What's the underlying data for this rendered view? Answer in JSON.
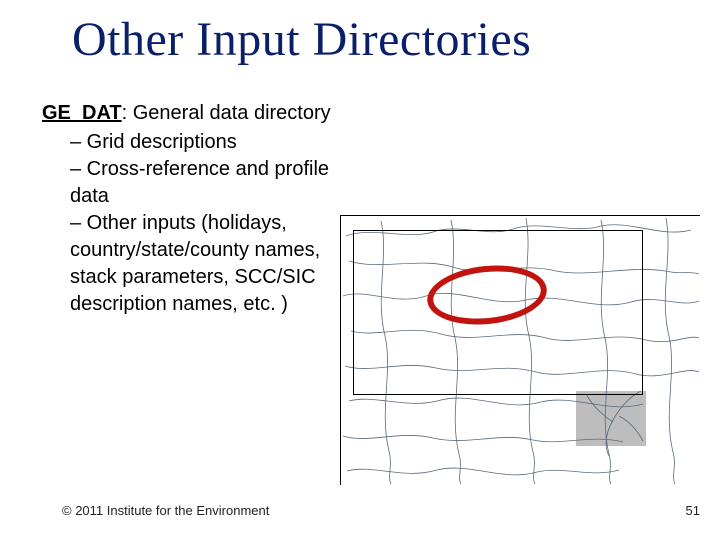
{
  "title": "Other Input Directories",
  "lead": {
    "label": "GE_DAT",
    "rest": ": General data directory"
  },
  "items": {
    "a": "– Grid descriptions",
    "b": "– Cross-reference and profile data",
    "c": "– Other inputs (holidays, country/state/county names, stack parameters, SCC/SIC description names, etc. )"
  },
  "footer": {
    "copyright": "© 2011 Institute for the Environment",
    "page": "51"
  }
}
